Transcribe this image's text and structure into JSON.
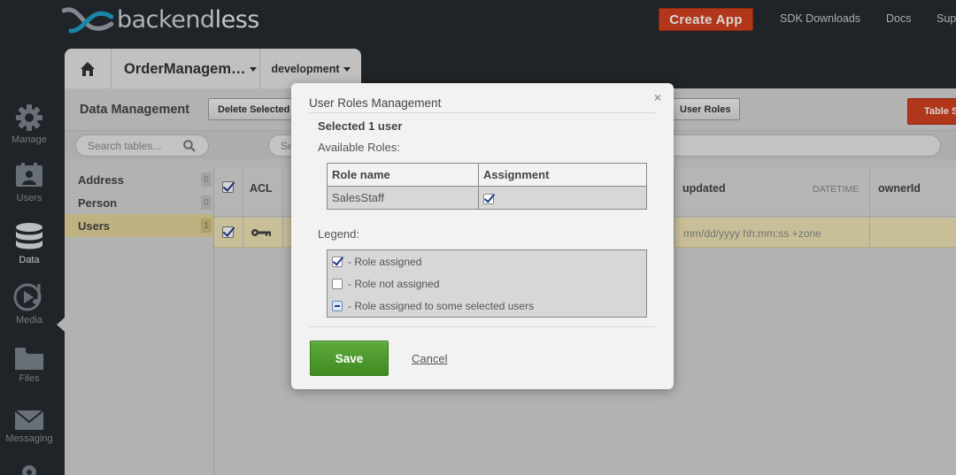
{
  "brand": {
    "logo_text_regular": "backend",
    "logo_text_bold": "less"
  },
  "topbar": {
    "create_app": "Create App",
    "links": [
      "SDK Downloads",
      "Docs",
      "Sup"
    ]
  },
  "nav": [
    {
      "label": "Manage",
      "icon": "gear-icon"
    },
    {
      "label": "Users",
      "icon": "users-icon"
    },
    {
      "label": "Data",
      "icon": "database-icon",
      "active": true
    },
    {
      "label": "Media",
      "icon": "media-icon"
    },
    {
      "label": "Files",
      "icon": "folder-icon"
    },
    {
      "label": "Messaging",
      "icon": "envelope-icon"
    }
  ],
  "app_tabs": {
    "app_name": "OrderManagem…",
    "environment": "development"
  },
  "data_management": {
    "title": "Data Management",
    "delete_selected": "Delete Selected",
    "user_roles": "User Roles",
    "table_schema": "Table S",
    "search_tables_placeholder": "Search tables...",
    "search_data_placeholder": "Se"
  },
  "tables": [
    {
      "name": "Address",
      "count": "0"
    },
    {
      "name": "Person",
      "count": "0"
    },
    {
      "name": "Users",
      "count": "1",
      "active": true
    }
  ],
  "grid": {
    "columns": [
      {
        "name": "ACL"
      },
      {
        "name": "updated",
        "type": "DATETIME"
      },
      {
        "name": "ownerId"
      }
    ],
    "row_updated_placeholder": "mm/dd/yyyy hh:mm:ss +zone"
  },
  "modal": {
    "title": "User Roles Management",
    "close": "×",
    "selected_text": "Selected 1 user",
    "available_roles_label": "Available Roles:",
    "table_headers": {
      "role_name": "Role name",
      "assignment": "Assignment"
    },
    "roles": [
      {
        "name": "SalesStaff",
        "assigned": true
      }
    ],
    "legend_label": "Legend:",
    "legend": {
      "assigned": "- Role assigned",
      "not_assigned": "- Role not assigned",
      "partial": "- Role assigned to some selected users"
    },
    "save": "Save",
    "cancel": "Cancel"
  },
  "colors": {
    "accent_orange": "#d5411e",
    "save_green": "#4b9a2c",
    "selected_row": "#efe4b5",
    "background_dark": "#262b30"
  }
}
